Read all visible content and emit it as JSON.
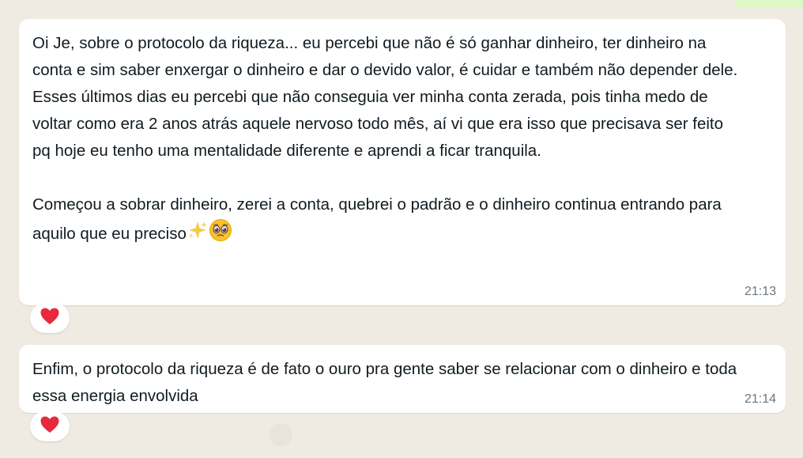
{
  "chat": {
    "messages": [
      {
        "text": "Oi Je, sobre o protocolo da riqueza... eu percebi que não é só ganhar dinheiro, ter dinheiro na conta e sim saber enxergar o dinheiro e dar o devido valor, é cuidar e também não depender dele.\nEsses últimos dias eu percebi que não conseguia ver minha conta zerada, pois tinha medo de voltar como era 2 anos atrás aquele nervoso todo mês, aí vi que era isso que precisava ser feito pq hoje eu tenho uma mentalidade diferente e aprendi a ficar tranquila.\n\nComeçou a sobrar dinheiro, zerei a conta, quebrei o padrão e o dinheiro continua entrando para aquilo que eu preciso",
        "emojis": [
          "sparkles-icon",
          "pleading-face-icon"
        ],
        "time": "21:13",
        "reaction": "heart-icon"
      },
      {
        "text": "Enfim, o protocolo da riqueza é de fato o ouro pra gente saber se relacionar com o dinheiro e toda essa energia envolvida",
        "time": "21:14",
        "reaction": "heart-icon"
      }
    ]
  },
  "colors": {
    "background": "#efeae2",
    "bubble": "#ffffff",
    "text": "#111b21",
    "timestamp": "#667781",
    "heart": "#e8283b"
  }
}
